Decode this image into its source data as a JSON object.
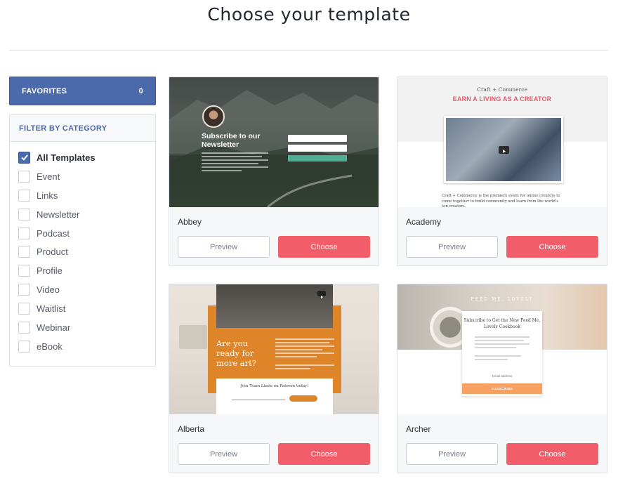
{
  "header": {
    "title": "Choose your template"
  },
  "sidebar": {
    "favorites": {
      "label": "FAVORITES",
      "count": "0"
    },
    "filter_heading": "FILTER BY CATEGORY",
    "categories": [
      {
        "label": "All Templates",
        "checked": true
      },
      {
        "label": "Event",
        "checked": false
      },
      {
        "label": "Links",
        "checked": false
      },
      {
        "label": "Newsletter",
        "checked": false
      },
      {
        "label": "Podcast",
        "checked": false
      },
      {
        "label": "Product",
        "checked": false
      },
      {
        "label": "Profile",
        "checked": false
      },
      {
        "label": "Video",
        "checked": false
      },
      {
        "label": "Waitlist",
        "checked": false
      },
      {
        "label": "Webinar",
        "checked": false
      },
      {
        "label": "eBook",
        "checked": false
      }
    ]
  },
  "templates": [
    {
      "name": "Abbey",
      "preview_label": "Preview",
      "choose_label": "Choose",
      "thumb": {
        "heading": "Subscribe to our Newsletter"
      }
    },
    {
      "name": "Academy",
      "preview_label": "Preview",
      "choose_label": "Choose",
      "thumb": {
        "kicker": "Craft + Commerce",
        "heading": "EARN A LIVING AS A CREATOR",
        "body": "Craft + Commerce is the premiere event for online creators to come together to build community and learn from the world's top creators."
      }
    },
    {
      "name": "Alberta",
      "preview_label": "Preview",
      "choose_label": "Choose",
      "thumb": {
        "heading": "Are you ready for more art?",
        "form_title": "Join Team Lizzie on Patreon today!"
      }
    },
    {
      "name": "Archer",
      "preview_label": "Preview",
      "choose_label": "Choose",
      "thumb": {
        "brand": "FEED ME, LOVELY",
        "heading": "Subscribe to Get the New Feed Me, Lovely Cookbook",
        "field": "Email address",
        "button": "SUBSCRIBE"
      }
    }
  ],
  "colors": {
    "accent": "#4b6aab",
    "choose": "#f15d68"
  }
}
